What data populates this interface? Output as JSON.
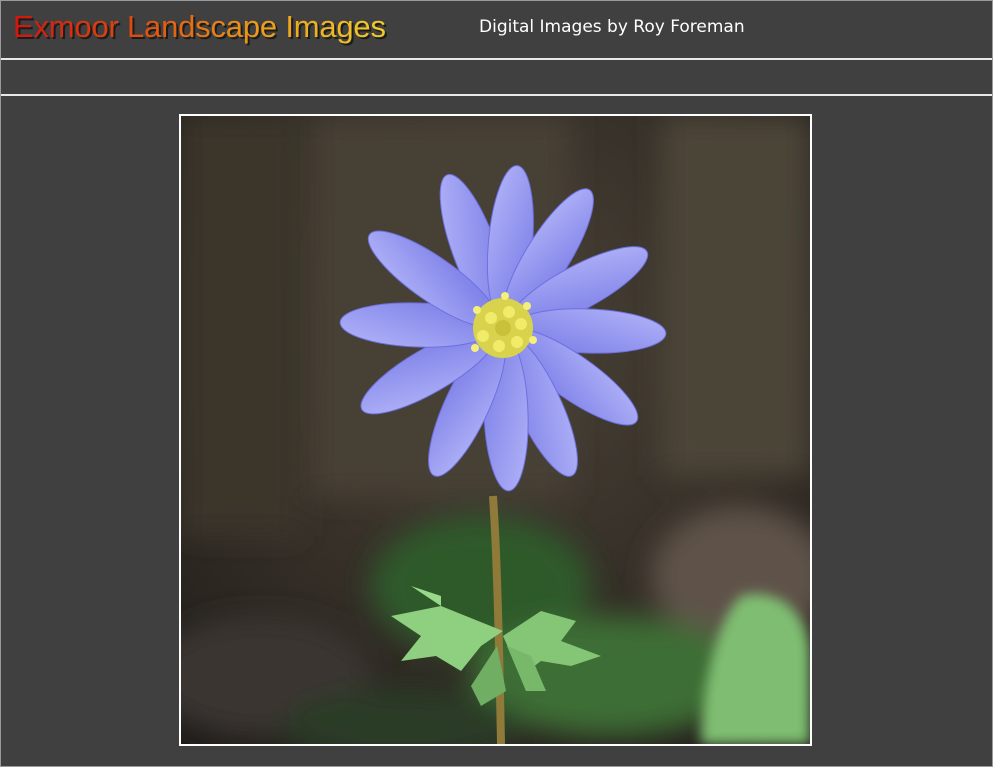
{
  "header": {
    "title": "Exmoor Landscape Images",
    "tagline": "Digital Images by Roy Foreman"
  },
  "photo": {
    "subject": "blue-anemone-flower",
    "colors": {
      "petal": "#8a8df0",
      "petal_light": "#a9acf7",
      "stamen": "#e9e25a",
      "stem": "#8f7a3a",
      "leaf": "#7db871",
      "background": "#2e2a26"
    }
  }
}
